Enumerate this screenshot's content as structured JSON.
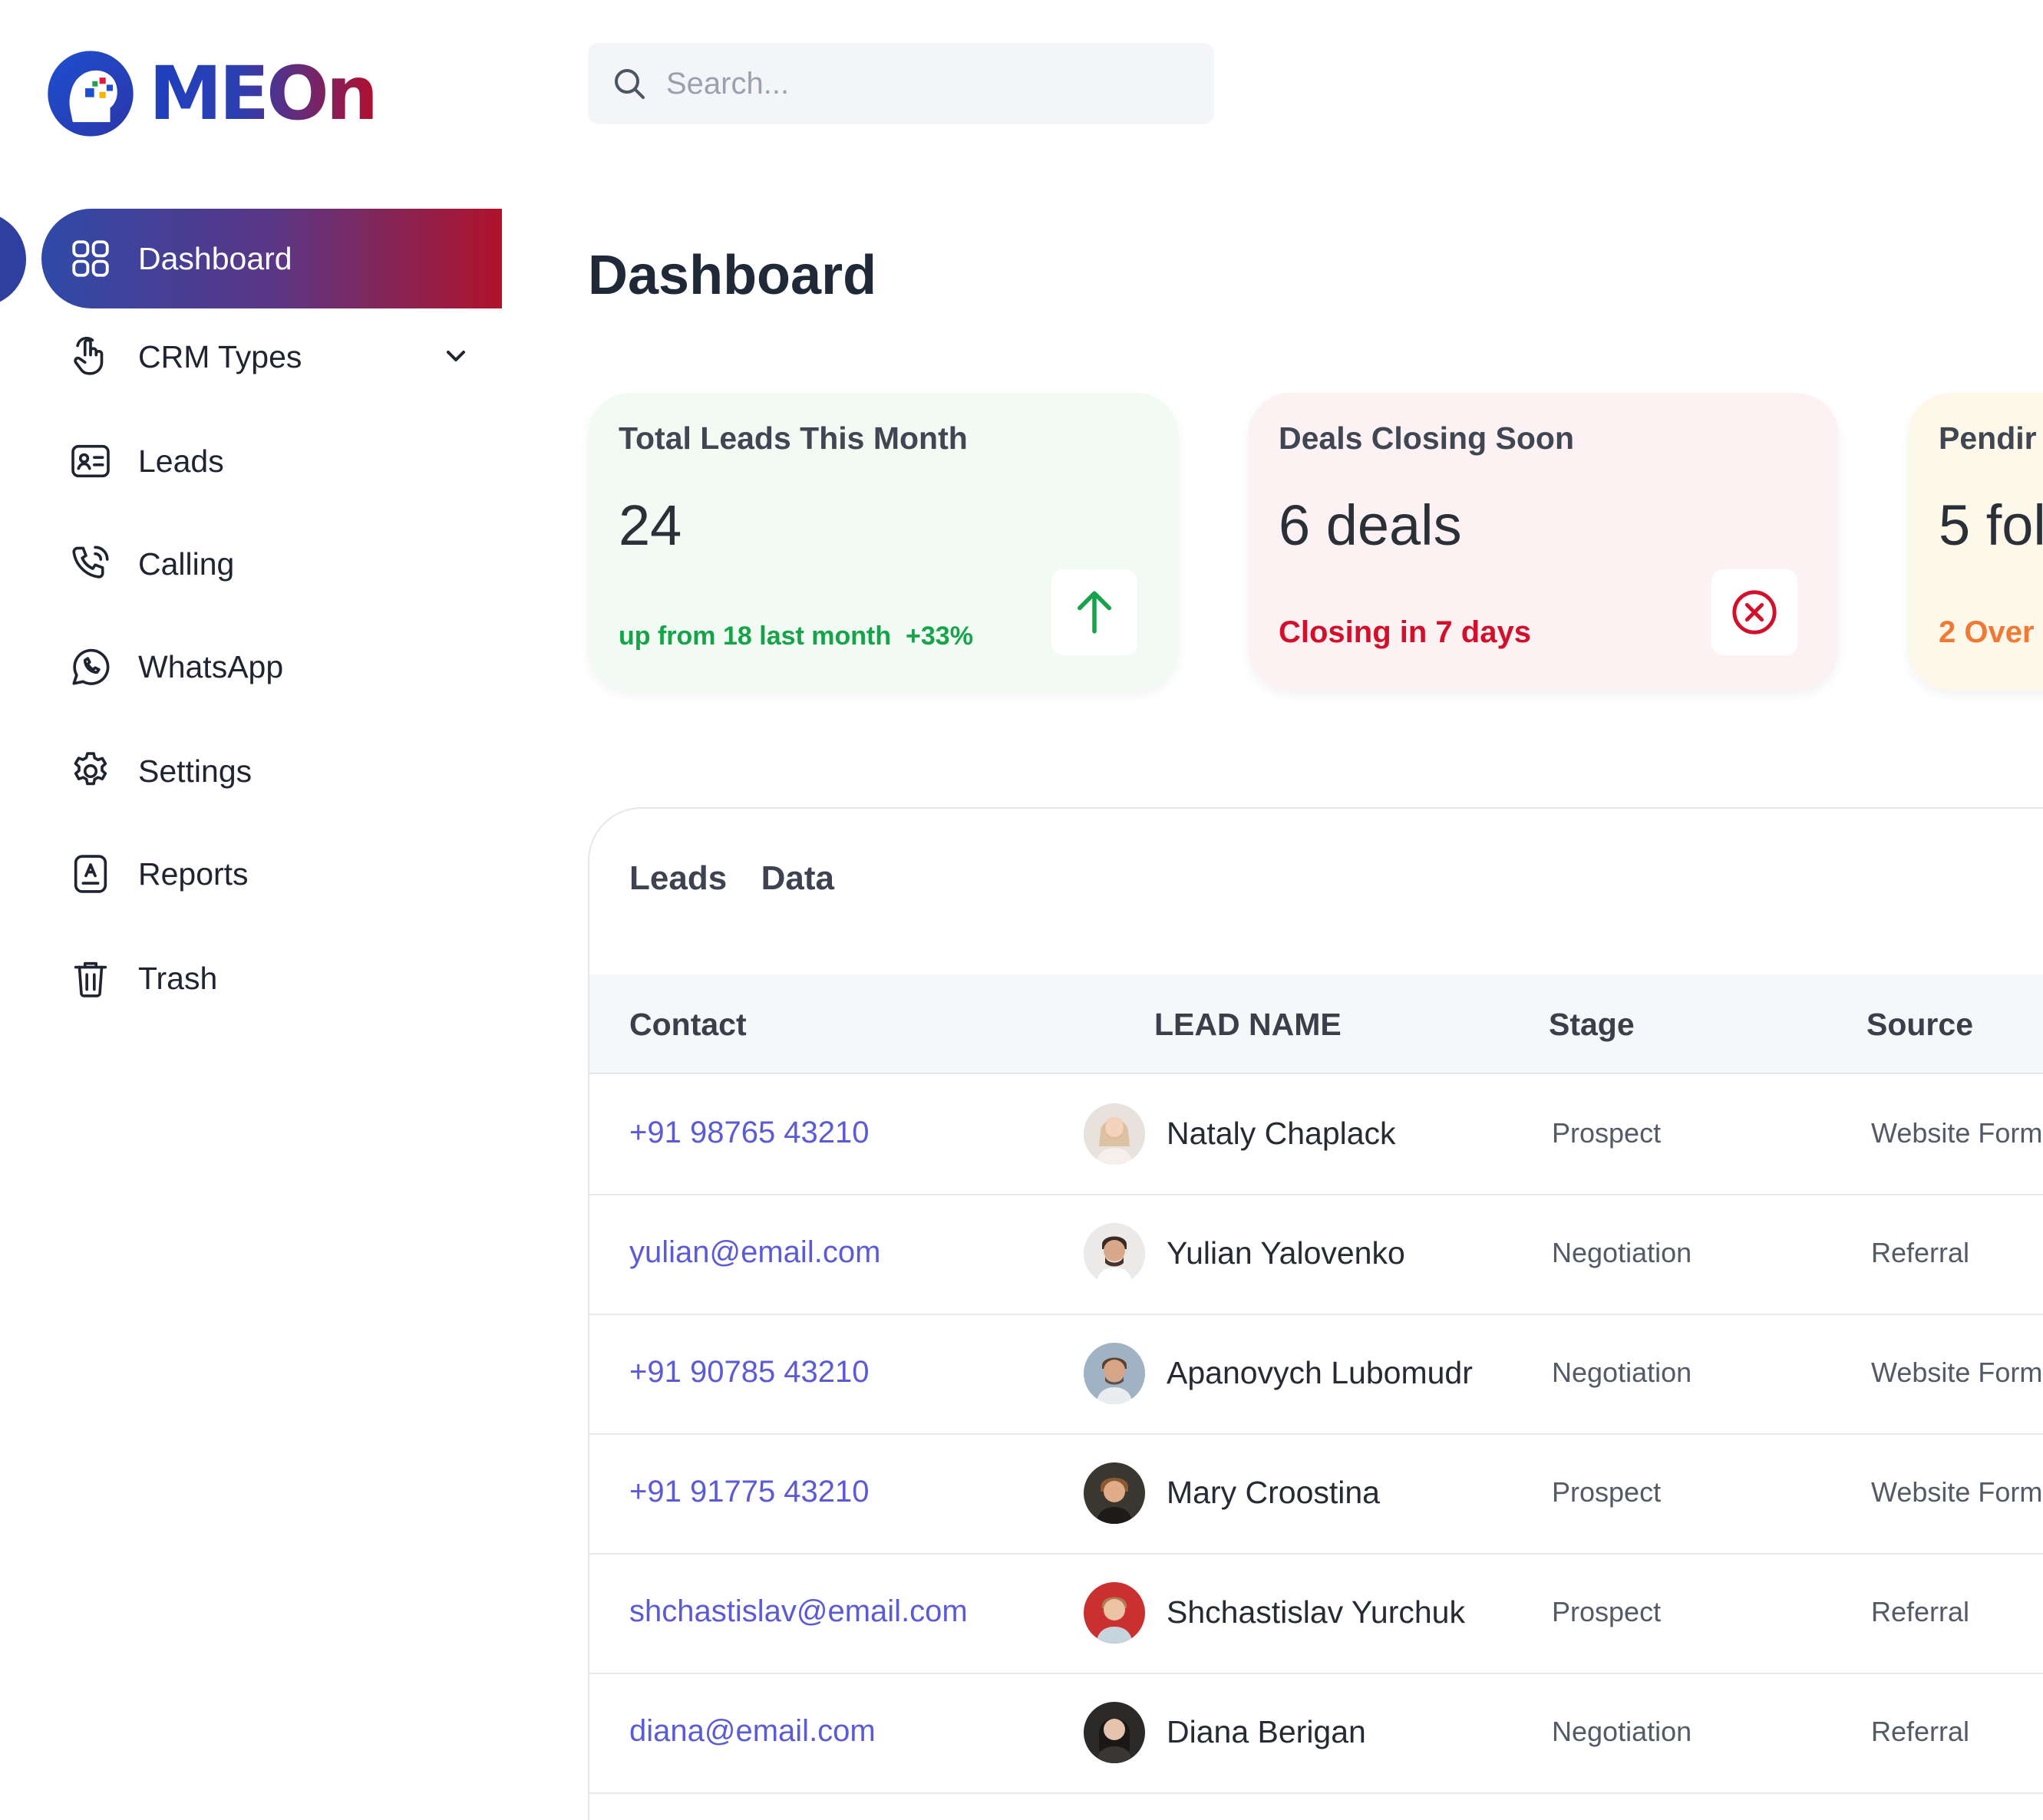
{
  "brand": {
    "name": "MEOn"
  },
  "search": {
    "placeholder": "Search..."
  },
  "sidebar": {
    "items": [
      {
        "label": "Dashboard",
        "icon": "dashboard-grid-icon",
        "active": true
      },
      {
        "label": "CRM Types",
        "icon": "hand-pointer-icon",
        "has_submenu": true
      },
      {
        "label": "Leads",
        "icon": "contact-card-icon"
      },
      {
        "label": "Calling",
        "icon": "phone-icon"
      },
      {
        "label": "WhatsApp",
        "icon": "whatsapp-icon"
      },
      {
        "label": "Settings",
        "icon": "gear-icon"
      },
      {
        "label": "Reports",
        "icon": "report-icon"
      },
      {
        "label": "Trash",
        "icon": "trash-icon"
      }
    ]
  },
  "main": {
    "title": "Dashboard",
    "cards": [
      {
        "title": "Total Leads This Month",
        "value": "24",
        "subtitle": "up from 18 last month  +33%",
        "icon": "arrow-up-icon",
        "accent": "#17a34a"
      },
      {
        "title": "Deals Closing Soon",
        "value": "6 deals",
        "subtitle": "Closing in 7 days",
        "icon": "close-circle-icon",
        "accent": "#d2102c"
      },
      {
        "title": "Pendir",
        "value": "5 fol",
        "subtitle": "2 Over",
        "accent": "#f07a35"
      }
    ],
    "leads": {
      "title": "Leads  Data",
      "columns": [
        "Contact",
        "LEAD NAME",
        "Stage",
        "Source"
      ],
      "rows": [
        {
          "contact": "+91 98765 43210",
          "name": "Nataly Chaplack",
          "stage": "Prospect",
          "source": "Website Form"
        },
        {
          "contact": "yulian@email.com",
          "name": "Yulian Yalovenko",
          "stage": "Negotiation",
          "source": "Referral"
        },
        {
          "contact": "+91 90785 43210",
          "name": "Apanovych Lubomudr",
          "stage": "Negotiation",
          "source": "Website Form"
        },
        {
          "contact": "+91 91775 43210",
          "name": "Mary Croostina",
          "stage": "Prospect",
          "source": "Website Form"
        },
        {
          "contact": "shchastislav@email.com",
          "name": "Shchastislav Yurchuk",
          "stage": "Prospect",
          "source": "Referral"
        },
        {
          "contact": "diana@email.com",
          "name": "Diana Berigan",
          "stage": "Negotiation",
          "source": "Referral"
        }
      ]
    }
  }
}
